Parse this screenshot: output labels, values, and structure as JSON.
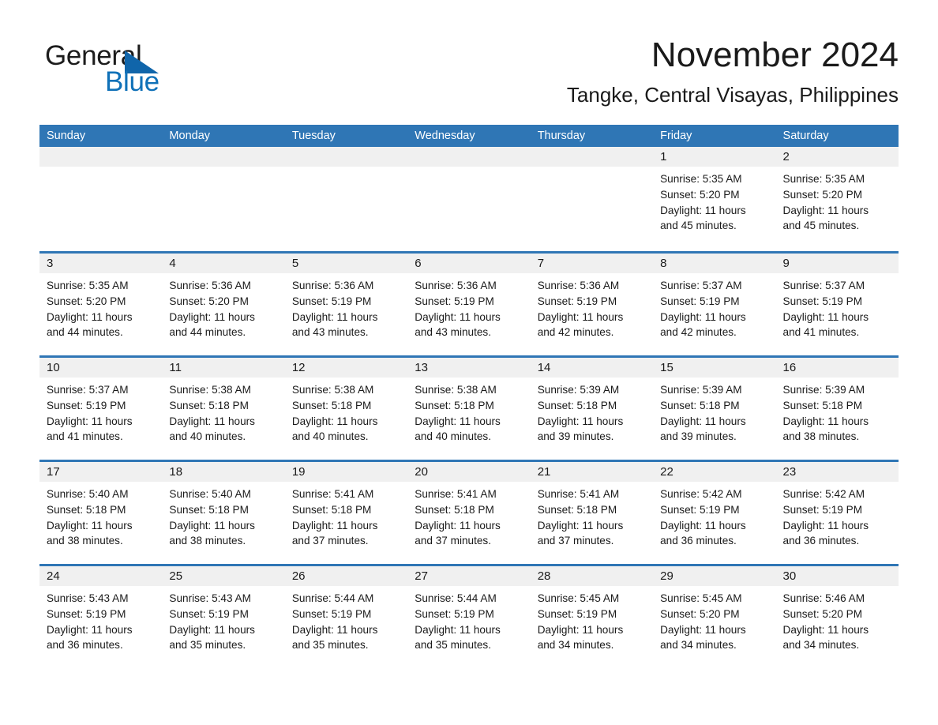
{
  "brand": {
    "line1": "General",
    "line2": "Blue",
    "triangle_color": "#1065aa",
    "text_color_primary": "#1c1c1c",
    "text_color_accent": "#1071b8"
  },
  "header": {
    "title": "November 2024",
    "subtitle": "Tangke, Central Visayas, Philippines"
  },
  "theme": {
    "header_bar": "#2f76b5",
    "daynum_band": "#f0f0f0",
    "page_background": "#ffffff",
    "text": "#1a1a1a"
  },
  "weekdays": [
    "Sunday",
    "Monday",
    "Tuesday",
    "Wednesday",
    "Thursday",
    "Friday",
    "Saturday"
  ],
  "weeks": [
    [
      {
        "day": "",
        "sunrise": "",
        "sunset": "",
        "daylight_line1": "",
        "daylight_line2": ""
      },
      {
        "day": "",
        "sunrise": "",
        "sunset": "",
        "daylight_line1": "",
        "daylight_line2": ""
      },
      {
        "day": "",
        "sunrise": "",
        "sunset": "",
        "daylight_line1": "",
        "daylight_line2": ""
      },
      {
        "day": "",
        "sunrise": "",
        "sunset": "",
        "daylight_line1": "",
        "daylight_line2": ""
      },
      {
        "day": "",
        "sunrise": "",
        "sunset": "",
        "daylight_line1": "",
        "daylight_line2": ""
      },
      {
        "day": "1",
        "sunrise": "Sunrise: 5:35 AM",
        "sunset": "Sunset: 5:20 PM",
        "daylight_line1": "Daylight: 11 hours",
        "daylight_line2": "and 45 minutes."
      },
      {
        "day": "2",
        "sunrise": "Sunrise: 5:35 AM",
        "sunset": "Sunset: 5:20 PM",
        "daylight_line1": "Daylight: 11 hours",
        "daylight_line2": "and 45 minutes."
      }
    ],
    [
      {
        "day": "3",
        "sunrise": "Sunrise: 5:35 AM",
        "sunset": "Sunset: 5:20 PM",
        "daylight_line1": "Daylight: 11 hours",
        "daylight_line2": "and 44 minutes."
      },
      {
        "day": "4",
        "sunrise": "Sunrise: 5:36 AM",
        "sunset": "Sunset: 5:20 PM",
        "daylight_line1": "Daylight: 11 hours",
        "daylight_line2": "and 44 minutes."
      },
      {
        "day": "5",
        "sunrise": "Sunrise: 5:36 AM",
        "sunset": "Sunset: 5:19 PM",
        "daylight_line1": "Daylight: 11 hours",
        "daylight_line2": "and 43 minutes."
      },
      {
        "day": "6",
        "sunrise": "Sunrise: 5:36 AM",
        "sunset": "Sunset: 5:19 PM",
        "daylight_line1": "Daylight: 11 hours",
        "daylight_line2": "and 43 minutes."
      },
      {
        "day": "7",
        "sunrise": "Sunrise: 5:36 AM",
        "sunset": "Sunset: 5:19 PM",
        "daylight_line1": "Daylight: 11 hours",
        "daylight_line2": "and 42 minutes."
      },
      {
        "day": "8",
        "sunrise": "Sunrise: 5:37 AM",
        "sunset": "Sunset: 5:19 PM",
        "daylight_line1": "Daylight: 11 hours",
        "daylight_line2": "and 42 minutes."
      },
      {
        "day": "9",
        "sunrise": "Sunrise: 5:37 AM",
        "sunset": "Sunset: 5:19 PM",
        "daylight_line1": "Daylight: 11 hours",
        "daylight_line2": "and 41 minutes."
      }
    ],
    [
      {
        "day": "10",
        "sunrise": "Sunrise: 5:37 AM",
        "sunset": "Sunset: 5:19 PM",
        "daylight_line1": "Daylight: 11 hours",
        "daylight_line2": "and 41 minutes."
      },
      {
        "day": "11",
        "sunrise": "Sunrise: 5:38 AM",
        "sunset": "Sunset: 5:18 PM",
        "daylight_line1": "Daylight: 11 hours",
        "daylight_line2": "and 40 minutes."
      },
      {
        "day": "12",
        "sunrise": "Sunrise: 5:38 AM",
        "sunset": "Sunset: 5:18 PM",
        "daylight_line1": "Daylight: 11 hours",
        "daylight_line2": "and 40 minutes."
      },
      {
        "day": "13",
        "sunrise": "Sunrise: 5:38 AM",
        "sunset": "Sunset: 5:18 PM",
        "daylight_line1": "Daylight: 11 hours",
        "daylight_line2": "and 40 minutes."
      },
      {
        "day": "14",
        "sunrise": "Sunrise: 5:39 AM",
        "sunset": "Sunset: 5:18 PM",
        "daylight_line1": "Daylight: 11 hours",
        "daylight_line2": "and 39 minutes."
      },
      {
        "day": "15",
        "sunrise": "Sunrise: 5:39 AM",
        "sunset": "Sunset: 5:18 PM",
        "daylight_line1": "Daylight: 11 hours",
        "daylight_line2": "and 39 minutes."
      },
      {
        "day": "16",
        "sunrise": "Sunrise: 5:39 AM",
        "sunset": "Sunset: 5:18 PM",
        "daylight_line1": "Daylight: 11 hours",
        "daylight_line2": "and 38 minutes."
      }
    ],
    [
      {
        "day": "17",
        "sunrise": "Sunrise: 5:40 AM",
        "sunset": "Sunset: 5:18 PM",
        "daylight_line1": "Daylight: 11 hours",
        "daylight_line2": "and 38 minutes."
      },
      {
        "day": "18",
        "sunrise": "Sunrise: 5:40 AM",
        "sunset": "Sunset: 5:18 PM",
        "daylight_line1": "Daylight: 11 hours",
        "daylight_line2": "and 38 minutes."
      },
      {
        "day": "19",
        "sunrise": "Sunrise: 5:41 AM",
        "sunset": "Sunset: 5:18 PM",
        "daylight_line1": "Daylight: 11 hours",
        "daylight_line2": "and 37 minutes."
      },
      {
        "day": "20",
        "sunrise": "Sunrise: 5:41 AM",
        "sunset": "Sunset: 5:18 PM",
        "daylight_line1": "Daylight: 11 hours",
        "daylight_line2": "and 37 minutes."
      },
      {
        "day": "21",
        "sunrise": "Sunrise: 5:41 AM",
        "sunset": "Sunset: 5:18 PM",
        "daylight_line1": "Daylight: 11 hours",
        "daylight_line2": "and 37 minutes."
      },
      {
        "day": "22",
        "sunrise": "Sunrise: 5:42 AM",
        "sunset": "Sunset: 5:19 PM",
        "daylight_line1": "Daylight: 11 hours",
        "daylight_line2": "and 36 minutes."
      },
      {
        "day": "23",
        "sunrise": "Sunrise: 5:42 AM",
        "sunset": "Sunset: 5:19 PM",
        "daylight_line1": "Daylight: 11 hours",
        "daylight_line2": "and 36 minutes."
      }
    ],
    [
      {
        "day": "24",
        "sunrise": "Sunrise: 5:43 AM",
        "sunset": "Sunset: 5:19 PM",
        "daylight_line1": "Daylight: 11 hours",
        "daylight_line2": "and 36 minutes."
      },
      {
        "day": "25",
        "sunrise": "Sunrise: 5:43 AM",
        "sunset": "Sunset: 5:19 PM",
        "daylight_line1": "Daylight: 11 hours",
        "daylight_line2": "and 35 minutes."
      },
      {
        "day": "26",
        "sunrise": "Sunrise: 5:44 AM",
        "sunset": "Sunset: 5:19 PM",
        "daylight_line1": "Daylight: 11 hours",
        "daylight_line2": "and 35 minutes."
      },
      {
        "day": "27",
        "sunrise": "Sunrise: 5:44 AM",
        "sunset": "Sunset: 5:19 PM",
        "daylight_line1": "Daylight: 11 hours",
        "daylight_line2": "and 35 minutes."
      },
      {
        "day": "28",
        "sunrise": "Sunrise: 5:45 AM",
        "sunset": "Sunset: 5:19 PM",
        "daylight_line1": "Daylight: 11 hours",
        "daylight_line2": "and 34 minutes."
      },
      {
        "day": "29",
        "sunrise": "Sunrise: 5:45 AM",
        "sunset": "Sunset: 5:20 PM",
        "daylight_line1": "Daylight: 11 hours",
        "daylight_line2": "and 34 minutes."
      },
      {
        "day": "30",
        "sunrise": "Sunrise: 5:46 AM",
        "sunset": "Sunset: 5:20 PM",
        "daylight_line1": "Daylight: 11 hours",
        "daylight_line2": "and 34 minutes."
      }
    ]
  ]
}
